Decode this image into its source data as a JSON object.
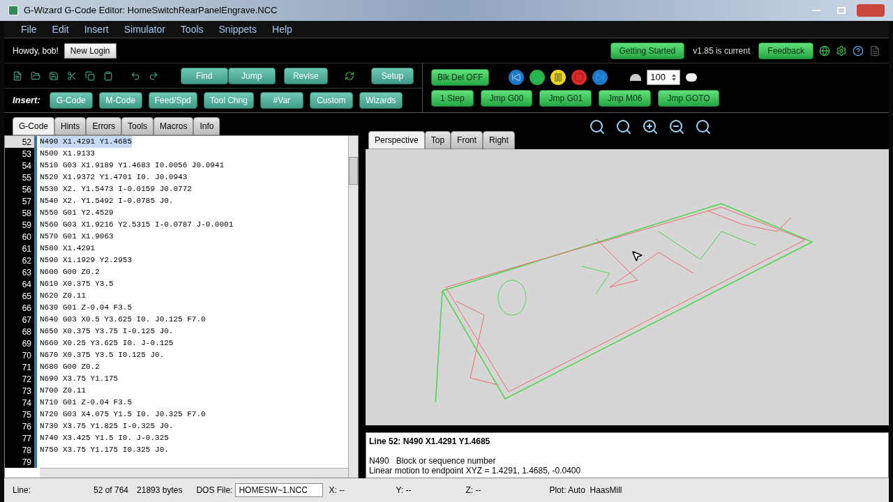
{
  "window": {
    "title": "G-Wizard G-Code Editor: HomeSwitchRearPanelEngrave.NCC"
  },
  "menu": [
    "File",
    "Edit",
    "Insert",
    "Simulator",
    "Tools",
    "Snippets",
    "Help"
  ],
  "user": {
    "greeting": "Howdy, bob!",
    "login_button": "New Login"
  },
  "header_right": {
    "getting_started": "Getting Started",
    "version": "v1.85 is current",
    "feedback": "Feedback"
  },
  "toolbar": {
    "buttons": [
      "Find",
      "Jump",
      "Revise"
    ],
    "setup": "Setup"
  },
  "insert": {
    "label": "Insert:",
    "buttons": [
      "G-Code",
      "M-Code",
      "Feed/Spd",
      "Tool Chng",
      "#Var",
      "Custom",
      "Wizards"
    ]
  },
  "sim": {
    "block_delete": "Blk Del OFF",
    "speed": "100",
    "buttons": [
      "1 Step",
      "Jmp G00",
      "Jmp G01",
      "Jmp M06",
      "Jmp GOTO"
    ]
  },
  "editor_tabs": [
    {
      "label": "G-Code",
      "selected": true
    },
    {
      "label": "Hints",
      "selected": false
    },
    {
      "label": "Errors",
      "selected": false
    },
    {
      "label": "Tools",
      "selected": false
    },
    {
      "label": "Macros",
      "selected": false
    },
    {
      "label": "Info",
      "selected": false
    }
  ],
  "code_lines": [
    {
      "number": "52",
      "text": "N490 X1.4291 Y1.4685",
      "selected": true
    },
    {
      "number": "53",
      "text": "N500 X1.9133",
      "selected": false
    },
    {
      "number": "54",
      "text": "N510 G03 X1.9189 Y1.4683 I0.0056 J0.0941",
      "selected": false
    },
    {
      "number": "55",
      "text": "N520 X1.9372 Y1.4701 I0. J0.0943",
      "selected": false
    },
    {
      "number": "56",
      "text": "N530 X2. Y1.5473 I-0.0159 J0.0772",
      "selected": false
    },
    {
      "number": "57",
      "text": "N540 X2. Y1.5492 I-0.0785 J0.",
      "selected": false
    },
    {
      "number": "58",
      "text": "N550 G01 Y2.4529",
      "selected": false
    },
    {
      "number": "59",
      "text": "N560 G03 X1.9216 Y2.5315 I-0.0787 J-0.0001",
      "selected": false
    },
    {
      "number": "60",
      "text": "N570 G01 X1.9063",
      "selected": false
    },
    {
      "number": "61",
      "text": "N580 X1.4291",
      "selected": false
    },
    {
      "number": "62",
      "text": "N590 X1.1929 Y2.2953",
      "selected": false
    },
    {
      "number": "63",
      "text": "N600 G00 Z0.2",
      "selected": false
    },
    {
      "number": "64",
      "text": "N610 X0.375 Y3.5",
      "selected": false
    },
    {
      "number": "65",
      "text": "N620 Z0.11",
      "selected": false
    },
    {
      "number": "66",
      "text": "N630 G01 Z-0.04 F3.5",
      "selected": false
    },
    {
      "number": "67",
      "text": "N640 G03 X0.5 Y3.625 I0. J0.125 F7.0",
      "selected": false
    },
    {
      "number": "68",
      "text": "N650 X0.375 Y3.75 I-0.125 J0.",
      "selected": false
    },
    {
      "number": "69",
      "text": "N660 X0.25 Y3.625 I0. J-0.125",
      "selected": false
    },
    {
      "number": "70",
      "text": "N670 X0.375 Y3.5 I0.125 J0.",
      "selected": false
    },
    {
      "number": "71",
      "text": "N680 G00 Z0.2",
      "selected": false
    },
    {
      "number": "72",
      "text": "N690 X3.75 Y1.175",
      "selected": false
    },
    {
      "number": "73",
      "text": "N700 Z0.11",
      "selected": false
    },
    {
      "number": "74",
      "text": "N710 G01 Z-0.04 F3.5",
      "selected": false
    },
    {
      "number": "75",
      "text": "N720 G03 X4.075 Y1.5 I0. J0.325 F7.0",
      "selected": false
    },
    {
      "number": "76",
      "text": "N730 X3.75 Y1.825 I-0.325 J0.",
      "selected": false
    },
    {
      "number": "77",
      "text": "N740 X3.425 Y1.5 I0. J-0.325",
      "selected": false
    },
    {
      "number": "78",
      "text": "N750 X3.75 Y1.175 I0.325 J0.",
      "selected": false
    },
    {
      "number": "79",
      "selected": false
    }
  ],
  "view_tabs": [
    {
      "label": "Perspective",
      "selected": true
    },
    {
      "label": "Top",
      "selected": false
    },
    {
      "label": "Front",
      "selected": false
    },
    {
      "label": "Right",
      "selected": false
    }
  ],
  "info_pane": {
    "heading": "Line 52: N490 X1.4291 Y1.4685",
    "lines": [
      "N490   Block or sequence number",
      "Linear motion to endpoint XYZ = 1.4291, 1.4685, -0.0400"
    ]
  },
  "status_bar": {
    "line_label": "Line:",
    "line_value": "52 of 764",
    "size": "21893 bytes",
    "dos_label": "DOS File:",
    "dos_value": "HOMESW~1.NCC",
    "x": "X: --",
    "y": "Y: --",
    "z": "Z: --",
    "plot": "Plot: Auto  HaasMill"
  }
}
